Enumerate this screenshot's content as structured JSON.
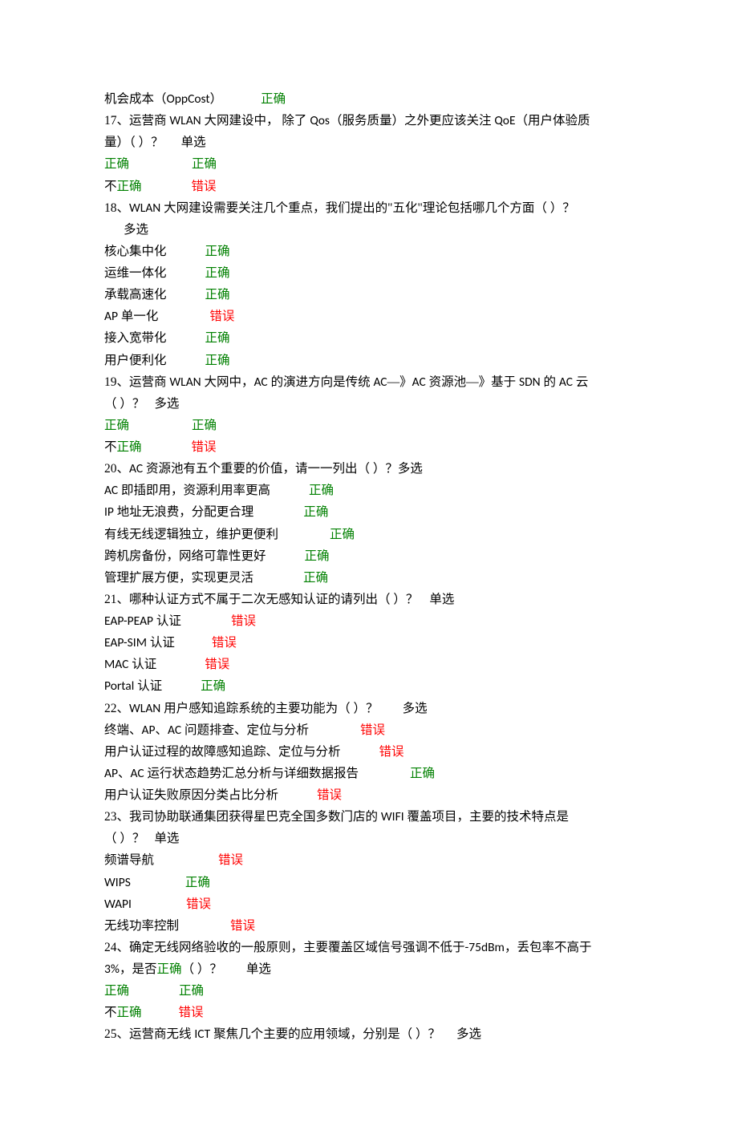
{
  "correct": "正确",
  "wrong": "错误",
  "not": "不",
  "danxuan": "单选",
  "duoxuan": "多选",
  "l_intro_1": "机会成本（",
  "l_intro_2": "OppCost",
  "l_intro_3": "）",
  "q17_a": "17、运营商 ",
  "q17_b": "WLAN",
  "q17_c": " 大网建设中， 除了 ",
  "q17_d": "Qos",
  "q17_e": "（服务质量）之外更应该关注 ",
  "q17_f": "QoE",
  "q17_g": "（用户体验质",
  "q17_h": "量）（ ）？",
  "q18_a": "18、",
  "q18_b": "WLAN",
  "q18_c": " 大网建设需要关注几个重点，我们提出的\"五化\"理论包括哪几个方面（ ）？",
  "q18_o1": "核心集中化",
  "q18_o2": "运维一体化",
  "q18_o3": "承载高速化",
  "q18_o4a": "AP",
  "q18_o4b": " 单一化",
  "q18_o5": "接入宽带化",
  "q18_o6": "用户便利化",
  "q19_a": "19、运营商 ",
  "q19_b": "WLAN",
  "q19_c": " 大网中，",
  "q19_d": "AC",
  "q19_e": " 的演进方向是传统 ",
  "q19_f": "AC",
  "q19_g": "—》",
  "q19_h": "AC",
  "q19_i": " 资源池—》基于 ",
  "q19_j": "SDN",
  "q19_k": " 的 ",
  "q19_l": "AC",
  "q19_m": " 云",
  "q19_n": "（ ）？",
  "q20_a": "20、",
  "q20_b": "AC",
  "q20_c": " 资源池有五个重要的价值，请一一列出（ ）？",
  "q20_o1a": "AC",
  "q20_o1b": " 即插即用，资源利用率更高",
  "q20_o2a": "IP",
  "q20_o2b": " 地址无浪费，分配更合理",
  "q20_o3": "有线无线逻辑独立，维护更便利",
  "q20_o4": "跨机房备份，网络可靠性更好",
  "q20_o5": "管理扩展方便，实现更灵活",
  "q21_a": "21、哪种认证方式不属于二次无感知认证的请列出（ ）？",
  "q21_o1a": "EAP-PEAP",
  "q21_o1b": " 认证",
  "q21_o2a": "EAP-SIM",
  "q21_o2b": " 认证",
  "q21_o3a": "MAC",
  "q21_o3b": " 认证",
  "q21_o4a": "Portal",
  "q21_o4b": " 认证",
  "q22_a": "22、",
  "q22_b": "WLAN",
  "q22_c": " 用户感知追踪系统的主要功能为（ ）？",
  "q22_o1a": "终端、",
  "q22_o1b": "AP",
  "q22_o1c": "、",
  "q22_o1d": "AC",
  "q22_o1e": " 问题排查、定位与分析",
  "q22_o2": "用户认证过程的故障感知追踪、定位与分析",
  "q22_o3a": "AP",
  "q22_o3b": "、",
  "q22_o3c": "AC",
  "q22_o3d": " 运行状态趋势汇总分析与详细数据报告",
  "q22_o4": "用户认证失败原因分类占比分析",
  "q23_a": "23、我司协助联通集团获得星巴克全国多数门店的 ",
  "q23_b": "WIFI",
  "q23_c": " 覆盖项目，主要的技术特点是",
  "q23_d": "（ ）？",
  "q23_o1": "频谱导航",
  "q23_o2": "WIPS",
  "q23_o3": "WAPI",
  "q23_o4": "无线功率控制",
  "q24_a": "24、确定无线网络验收的一般原则，主要覆盖区域信号强调不低于",
  "q24_b": "-75dBm",
  "q24_c": "，丢包率不高于",
  "q24_d": "3%",
  "q24_e": "，是否",
  "q24_f": "（ ）？",
  "q25_a": "25、运营商无线 ",
  "q25_b": "ICT",
  "q25_c": " 聚焦几个主要的应用领域，分别是（ ）？"
}
